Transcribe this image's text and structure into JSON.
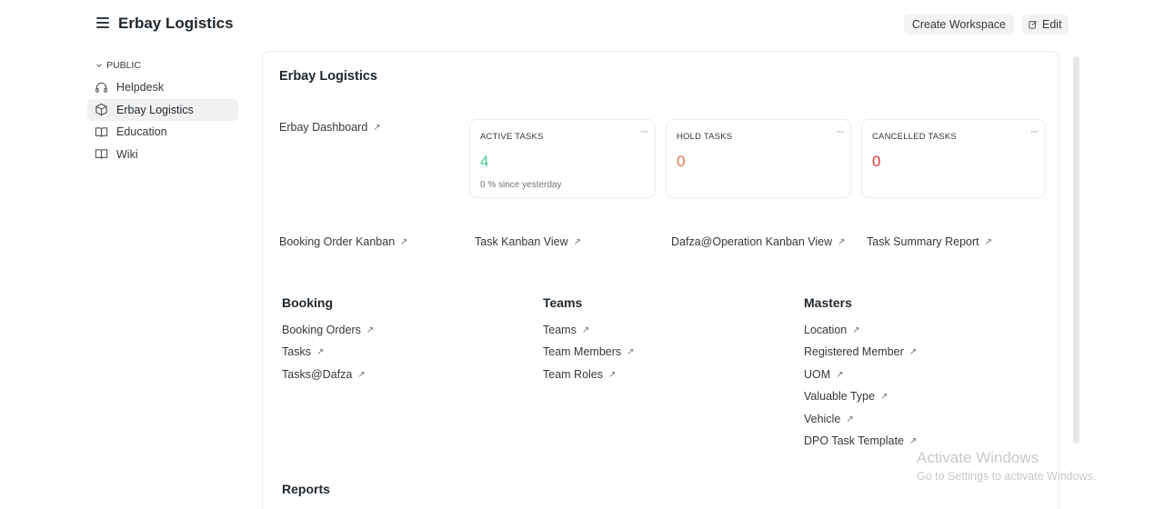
{
  "header": {
    "title": "Erbay Logistics",
    "create_label": "Create Workspace",
    "edit_label": "Edit"
  },
  "sidebar": {
    "section": "PUBLIC",
    "items": [
      {
        "label": "Helpdesk",
        "icon": "headset-icon"
      },
      {
        "label": "Erbay Logistics",
        "icon": "cube-icon",
        "active": true
      },
      {
        "label": "Education",
        "icon": "book-icon"
      },
      {
        "label": "Wiki",
        "icon": "book-open-icon"
      }
    ]
  },
  "workspace": {
    "title": "Erbay Logistics",
    "dashboard_link": "Erbay Dashboard",
    "number_cards": [
      {
        "label": "ACTIVE TASKS",
        "value": "4",
        "sub": "0 % since yesterday",
        "color": "#48c78e"
      },
      {
        "label": "HOLD TASKS",
        "value": "0",
        "color": "#e8744a"
      },
      {
        "label": "CANCELLED TASKS",
        "value": "0",
        "color": "#e03a3a"
      }
    ],
    "shortcuts": [
      "Booking Order Kanban",
      "Task Kanban View",
      "Dafza@Operation Kanban View",
      "Task Summary Report"
    ],
    "groups": [
      {
        "title": "Booking",
        "links": [
          "Booking Orders",
          "Tasks",
          "Tasks@Dafza"
        ]
      },
      {
        "title": "Teams",
        "links": [
          "Teams",
          "Team Members",
          "Team Roles"
        ]
      },
      {
        "title": "Masters",
        "links": [
          "Location",
          "Registered Member",
          "UOM",
          "Valuable Type",
          "Vehicle",
          "DPO Task Template"
        ]
      }
    ],
    "reports_title": "Reports"
  },
  "watermark": {
    "line1": "Activate Windows",
    "line2": "Go to Settings to activate Windows."
  }
}
